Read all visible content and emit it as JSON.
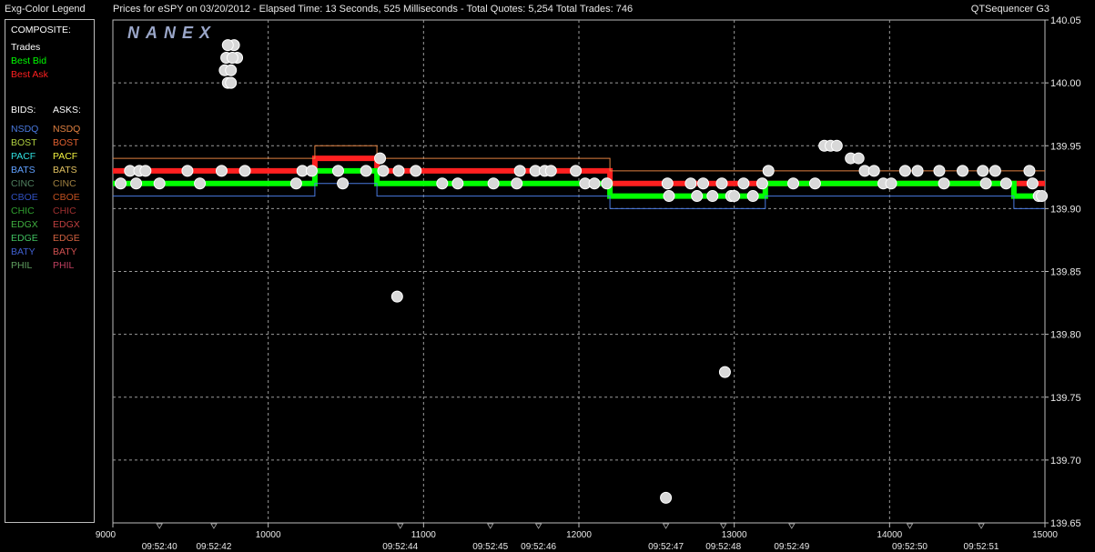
{
  "header": {
    "legend_title": "Exg-Color Legend",
    "chart_title": "Prices for  eSPY  on  03/20/2012  -  Elapsed Time: 13 Seconds, 525 Milliseconds  -  Total Quotes: 5,254  Total Trades: 746",
    "app_name": "QTSequencer G3"
  },
  "legend": {
    "composite_label": "COMPOSITE:",
    "composite": [
      {
        "label": "Trades",
        "color": "#ffffff"
      },
      {
        "label": "Best Bid",
        "color": "#00ff00"
      },
      {
        "label": "Best Ask",
        "color": "#ff2020"
      }
    ],
    "bids_label": "BIDS:",
    "asks_label": "ASKS:",
    "exchanges": [
      {
        "bid": "NSDQ",
        "bid_color": "#4a7ae0",
        "ask": "NSDQ",
        "ask_color": "#e08040"
      },
      {
        "bid": "BOST",
        "bid_color": "#b0d040",
        "ask": "BOST",
        "ask_color": "#e06030"
      },
      {
        "bid": "PACF",
        "bid_color": "#30e0e0",
        "ask": "PACF",
        "ask_color": "#f0f040"
      },
      {
        "bid": "BATS",
        "bid_color": "#60a0ff",
        "ask": "BATS",
        "ask_color": "#e0c060"
      },
      {
        "bid": "CINC",
        "bid_color": "#508060",
        "ask": "CINC",
        "ask_color": "#a08040"
      },
      {
        "bid": "CBOE",
        "bid_color": "#3050c0",
        "ask": "CBOE",
        "ask_color": "#c05020"
      },
      {
        "bid": "CHIC",
        "bid_color": "#30a030",
        "ask": "CHIC",
        "ask_color": "#a03030"
      },
      {
        "bid": "EDGX",
        "bid_color": "#40b040",
        "ask": "EDGX",
        "ask_color": "#c04040"
      },
      {
        "bid": "EDGE",
        "bid_color": "#40c060",
        "ask": "EDGE",
        "ask_color": "#d06040"
      },
      {
        "bid": "BATY",
        "bid_color": "#4060d0",
        "ask": "BATY",
        "ask_color": "#d05050"
      },
      {
        "bid": "PHIL",
        "bid_color": "#60a060",
        "ask": "PHIL",
        "ask_color": "#c04060"
      }
    ]
  },
  "chart_data": {
    "type": "scatter",
    "watermark": "NANEX",
    "x_range": [
      9000,
      15000
    ],
    "y_range": [
      139.65,
      140.05
    ],
    "x_ticks": [
      9000,
      10000,
      11000,
      12000,
      13000,
      14000,
      15000
    ],
    "y_ticks": [
      "140.05",
      "140.00",
      "139.95",
      "139.90",
      "139.85",
      "139.80",
      "139.75",
      "139.70",
      "139.65"
    ],
    "grid": true,
    "time_labels": [
      {
        "x": 9300,
        "label": "09:52:40"
      },
      {
        "x": 9650,
        "label": "09:52:42"
      },
      {
        "x": 10850,
        "label": "09:52:44"
      },
      {
        "x": 11430,
        "label": "09:52:45"
      },
      {
        "x": 11740,
        "label": "09:52:46"
      },
      {
        "x": 12560,
        "label": "09:52:47"
      },
      {
        "x": 12930,
        "label": "09:52:48"
      },
      {
        "x": 13370,
        "label": "09:52:49"
      },
      {
        "x": 14130,
        "label": "09:52:50"
      },
      {
        "x": 14590,
        "label": "09:52:51"
      }
    ],
    "best_ask": [
      [
        9000,
        139.93
      ],
      [
        10300,
        139.93
      ],
      [
        10300,
        139.94
      ],
      [
        10700,
        139.94
      ],
      [
        10700,
        139.93
      ],
      [
        12200,
        139.93
      ],
      [
        12200,
        139.92
      ],
      [
        15000,
        139.92
      ]
    ],
    "best_bid": [
      [
        9000,
        139.92
      ],
      [
        10300,
        139.92
      ],
      [
        10300,
        139.93
      ],
      [
        10700,
        139.93
      ],
      [
        10700,
        139.92
      ],
      [
        12200,
        139.92
      ],
      [
        12200,
        139.91
      ],
      [
        13200,
        139.91
      ],
      [
        13200,
        139.92
      ],
      [
        14800,
        139.92
      ],
      [
        14800,
        139.91
      ],
      [
        15000,
        139.91
      ]
    ],
    "trades": [
      [
        9780,
        140.03
      ],
      [
        9740,
        140.03
      ],
      [
        9800,
        140.02
      ],
      [
        9730,
        140.02
      ],
      [
        9770,
        140.02
      ],
      [
        9720,
        140.01
      ],
      [
        9760,
        140.01
      ],
      [
        9740,
        140.0
      ],
      [
        9760,
        140.0
      ],
      [
        9050,
        139.92
      ],
      [
        9110,
        139.93
      ],
      [
        9150,
        139.92
      ],
      [
        9170,
        139.93
      ],
      [
        9210,
        139.93
      ],
      [
        9300,
        139.92
      ],
      [
        9480,
        139.93
      ],
      [
        9560,
        139.92
      ],
      [
        9700,
        139.93
      ],
      [
        9850,
        139.93
      ],
      [
        10180,
        139.92
      ],
      [
        10220,
        139.93
      ],
      [
        10280,
        139.93
      ],
      [
        10450,
        139.93
      ],
      [
        10480,
        139.92
      ],
      [
        10630,
        139.93
      ],
      [
        10720,
        139.94
      ],
      [
        10740,
        139.93
      ],
      [
        10830,
        139.83
      ],
      [
        10840,
        139.93
      ],
      [
        10950,
        139.93
      ],
      [
        11120,
        139.92
      ],
      [
        11220,
        139.92
      ],
      [
        11450,
        139.92
      ],
      [
        11600,
        139.92
      ],
      [
        11620,
        139.93
      ],
      [
        11720,
        139.93
      ],
      [
        11780,
        139.93
      ],
      [
        11820,
        139.93
      ],
      [
        11980,
        139.93
      ],
      [
        12040,
        139.92
      ],
      [
        12100,
        139.92
      ],
      [
        12180,
        139.92
      ],
      [
        12560,
        139.67
      ],
      [
        12570,
        139.92
      ],
      [
        12580,
        139.91
      ],
      [
        12720,
        139.92
      ],
      [
        12760,
        139.91
      ],
      [
        12800,
        139.92
      ],
      [
        12860,
        139.91
      ],
      [
        12920,
        139.92
      ],
      [
        12940,
        139.77
      ],
      [
        12980,
        139.91
      ],
      [
        13000,
        139.91
      ],
      [
        13060,
        139.92
      ],
      [
        13120,
        139.91
      ],
      [
        13180,
        139.92
      ],
      [
        13220,
        139.93
      ],
      [
        13380,
        139.92
      ],
      [
        13520,
        139.92
      ],
      [
        13580,
        139.95
      ],
      [
        13620,
        139.95
      ],
      [
        13660,
        139.95
      ],
      [
        13750,
        139.94
      ],
      [
        13800,
        139.94
      ],
      [
        13840,
        139.93
      ],
      [
        13900,
        139.93
      ],
      [
        13960,
        139.92
      ],
      [
        14010,
        139.92
      ],
      [
        14100,
        139.93
      ],
      [
        14180,
        139.93
      ],
      [
        14320,
        139.93
      ],
      [
        14350,
        139.92
      ],
      [
        14470,
        139.93
      ],
      [
        14600,
        139.93
      ],
      [
        14620,
        139.92
      ],
      [
        14680,
        139.93
      ],
      [
        14750,
        139.92
      ],
      [
        14900,
        139.93
      ],
      [
        14920,
        139.92
      ],
      [
        14960,
        139.91
      ],
      [
        14980,
        139.91
      ]
    ]
  }
}
